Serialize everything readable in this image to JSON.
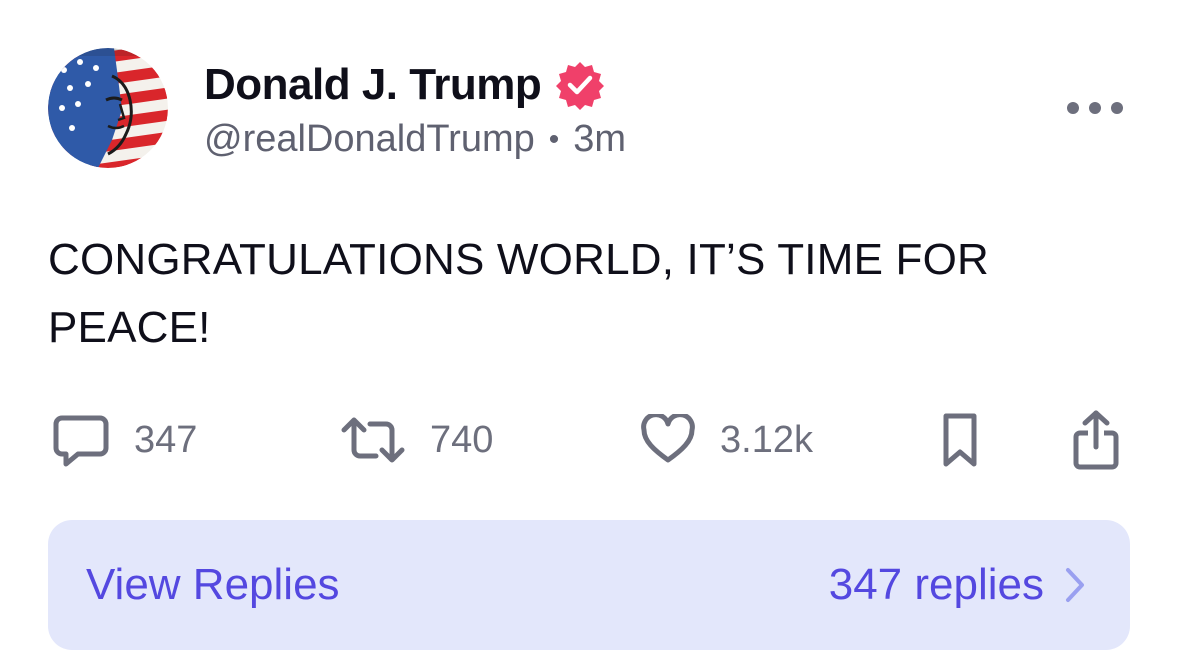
{
  "post": {
    "author_name": "Donald J. Trump",
    "handle": "@realDonaldTrump",
    "separator": "•",
    "time_ago": "3m",
    "body": "CONGRATULATIONS WORLD, IT’S TIME FOR PEACE!"
  },
  "actions": {
    "replies_count": "347",
    "reposts_count": "740",
    "likes_count": "3.12k"
  },
  "replies_bar": {
    "label": "View Replies",
    "count_text": "347 replies"
  },
  "icons": {
    "verified": "verified-badge-icon",
    "more": "more-horizontal-icon",
    "reply": "comment-bubble-icon",
    "repost": "repost-arrows-icon",
    "like": "heart-icon",
    "bookmark": "bookmark-icon",
    "share": "share-icon",
    "chevron": "chevron-right-icon"
  },
  "colors": {
    "verified_badge": "#f0406a",
    "accent": "#5448e0",
    "replies_bar_bg": "#e3e7fb",
    "muted_text": "#6d6f7d"
  }
}
